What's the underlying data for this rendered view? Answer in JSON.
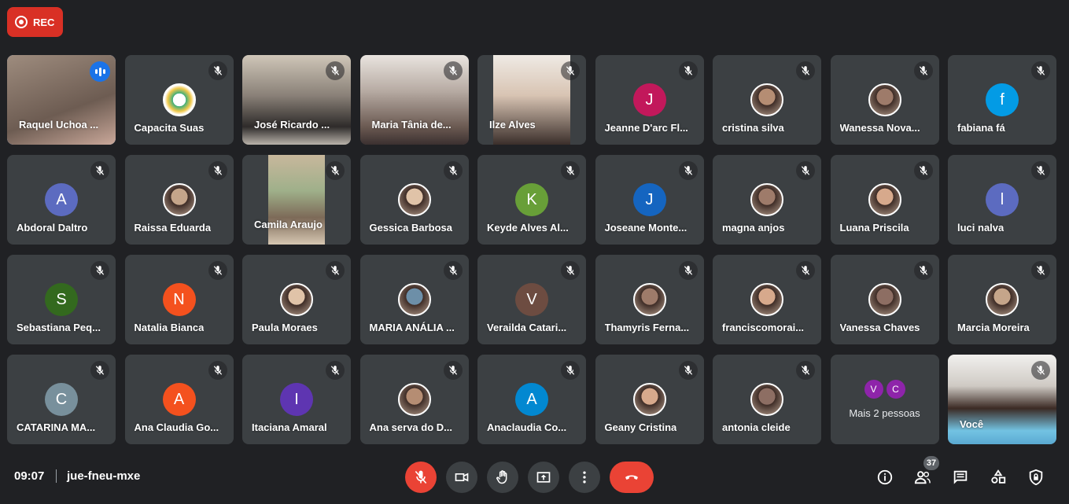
{
  "recording": {
    "label": "REC"
  },
  "meeting": {
    "time": "09:07",
    "code": "jue-fneu-mxe"
  },
  "colors": {
    "accent": "#1a73e8",
    "danger": "#ea4335",
    "tile": "#3c4043",
    "background": "#202124"
  },
  "participants": [
    {
      "name": "Raquel Uchoa ...",
      "kind": "video",
      "speaking": true
    },
    {
      "name": "Capacita Suas",
      "kind": "photo",
      "icon": "logo-avatar"
    },
    {
      "name": "José Ricardo ...",
      "kind": "video"
    },
    {
      "name": "Maria Tânia de...",
      "kind": "video"
    },
    {
      "name": "Ilze Alves",
      "kind": "video"
    },
    {
      "name": "Jeanne D'arc Fl...",
      "kind": "initial",
      "initial": "J",
      "color": "#c2185b"
    },
    {
      "name": "cristina silva",
      "kind": "photo"
    },
    {
      "name": "Wanessa Nova...",
      "kind": "photo"
    },
    {
      "name": "fabiana fá",
      "kind": "initial",
      "initial": "f",
      "color": "#039be5"
    },
    {
      "name": "Abdoral Daltro",
      "kind": "initial",
      "initial": "A",
      "color": "#5c6bc0"
    },
    {
      "name": "Raissa Eduarda",
      "kind": "photo"
    },
    {
      "name": "Camila Araujo",
      "kind": "video"
    },
    {
      "name": "Gessica Barbosa",
      "kind": "photo"
    },
    {
      "name": "Keyde Alves Al...",
      "kind": "initial",
      "initial": "K",
      "color": "#689f38"
    },
    {
      "name": "Joseane Monte...",
      "kind": "initial",
      "initial": "J",
      "color": "#1565c0"
    },
    {
      "name": "magna anjos",
      "kind": "photo"
    },
    {
      "name": "Luana Priscila",
      "kind": "photo"
    },
    {
      "name": "luci nalva",
      "kind": "initial",
      "initial": "l",
      "color": "#5c6bc0"
    },
    {
      "name": "Sebastiana Peq...",
      "kind": "initial",
      "initial": "S",
      "color": "#33691e"
    },
    {
      "name": "Natalia Bianca",
      "kind": "initial",
      "initial": "N",
      "color": "#f4511e"
    },
    {
      "name": "Paula Moraes",
      "kind": "photo"
    },
    {
      "name": "MARIA ANÁLIA ...",
      "kind": "photo"
    },
    {
      "name": "Verailda Catari...",
      "kind": "initial",
      "initial": "V",
      "color": "#6d4c41"
    },
    {
      "name": "Thamyris Ferna...",
      "kind": "photo"
    },
    {
      "name": "franciscomorai...",
      "kind": "photo"
    },
    {
      "name": "Vanessa Chaves",
      "kind": "photo"
    },
    {
      "name": "Marcia Moreira",
      "kind": "photo"
    },
    {
      "name": "CATARINA MA...",
      "kind": "initial",
      "initial": "C",
      "color": "#78909c"
    },
    {
      "name": "Ana Claudia Go...",
      "kind": "initial",
      "initial": "A",
      "color": "#f4511e"
    },
    {
      "name": "Itaciana Amaral",
      "kind": "initial",
      "initial": "I",
      "color": "#5e35b1"
    },
    {
      "name": "Ana serva do D...",
      "kind": "photo"
    },
    {
      "name": "Anaclaudia Co...",
      "kind": "initial",
      "initial": "A",
      "color": "#0288d1"
    },
    {
      "name": "Geany Cristina",
      "kind": "photo"
    },
    {
      "name": "antonia cleide",
      "kind": "photo"
    },
    {
      "name": "",
      "kind": "more",
      "initials": [
        "V",
        "C"
      ],
      "label": "Mais 2 pessoas"
    },
    {
      "name": "Você",
      "kind": "video",
      "self": true
    }
  ],
  "controls": {
    "center": [
      "microphone-off-icon",
      "camera-icon",
      "raise-hand-icon",
      "present-screen-icon",
      "more-options-icon",
      "leave-call-icon"
    ],
    "right": [
      "info-icon",
      "people-icon",
      "chat-icon",
      "activities-icon",
      "host-controls-icon"
    ],
    "people_count": "37"
  }
}
